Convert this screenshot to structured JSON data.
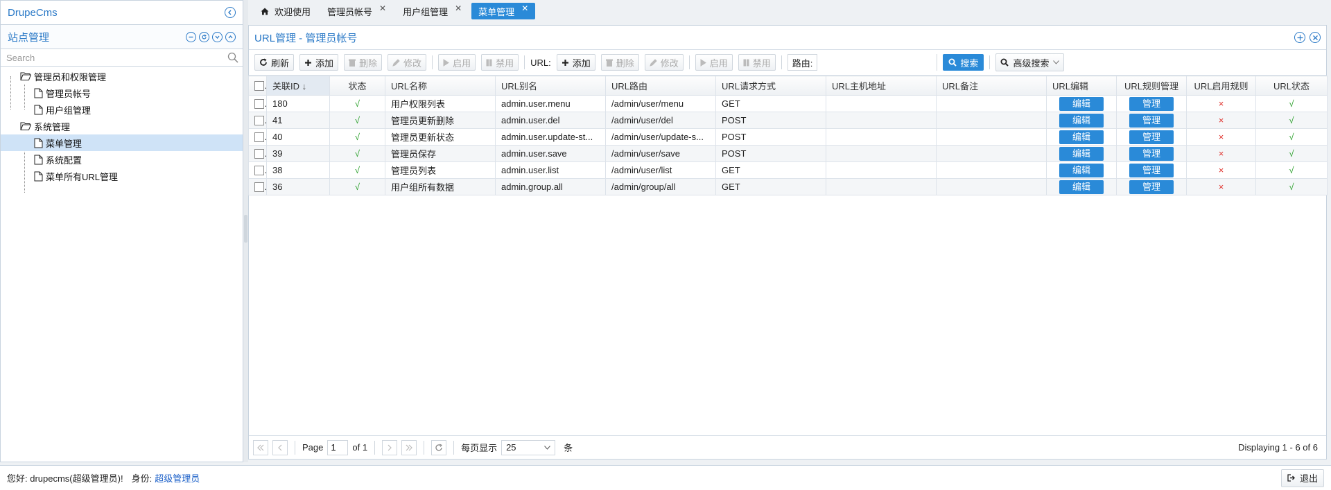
{
  "app": {
    "title": "DrupeCms"
  },
  "sidebar": {
    "title": "站点管理",
    "search_placeholder": "Search",
    "tree": [
      {
        "label": "管理员和权限管理",
        "type": "folder"
      },
      {
        "label": "管理员帐号",
        "type": "file"
      },
      {
        "label": "用户组管理",
        "type": "file"
      },
      {
        "label": "系统管理",
        "type": "folder"
      },
      {
        "label": "菜单管理",
        "type": "file"
      },
      {
        "label": "系统配置",
        "type": "file"
      },
      {
        "label": "菜单所有URL管理",
        "type": "file"
      }
    ]
  },
  "tabs": [
    {
      "label": "欢迎使用"
    },
    {
      "label": "管理员帐号"
    },
    {
      "label": "用户组管理"
    },
    {
      "label": "菜单管理"
    }
  ],
  "panel": {
    "title": "URL管理 - 管理员帐号"
  },
  "toolbar": {
    "refresh": "刷新",
    "add": "添加",
    "delete": "删除",
    "edit": "修改",
    "enable": "启用",
    "disable": "禁用",
    "url_label": "URL:",
    "url_add": "添加",
    "url_delete": "删除",
    "url_edit": "修改",
    "url_enable": "启用",
    "url_disable": "禁用",
    "route_label": "路由:",
    "route_value": "",
    "search": "搜索",
    "advanced": "高级搜索"
  },
  "grid": {
    "columns": [
      "关联ID",
      "状态",
      "URL名称",
      "URL别名",
      "URL路由",
      "URL请求方式",
      "URL主机地址",
      "URL备注",
      "URL编辑",
      "URL规则管理",
      "URL启用规则",
      "URL状态"
    ],
    "sort_arrow": "↓",
    "edit_label": "编辑",
    "manage_label": "管理",
    "rows": [
      {
        "id": "180",
        "status": "√",
        "name": "用户权限列表",
        "alias": "admin.user.menu",
        "route": "/admin/user/menu",
        "method": "GET",
        "host": "",
        "note": "",
        "rule": "×",
        "url_status": "√"
      },
      {
        "id": "41",
        "status": "√",
        "name": "管理员更新删除",
        "alias": "admin.user.del",
        "route": "/admin/user/del",
        "method": "POST",
        "host": "",
        "note": "",
        "rule": "×",
        "url_status": "√"
      },
      {
        "id": "40",
        "status": "√",
        "name": "管理员更新状态",
        "alias": "admin.user.update-st...",
        "route": "/admin/user/update-s...",
        "method": "POST",
        "host": "",
        "note": "",
        "rule": "×",
        "url_status": "√"
      },
      {
        "id": "39",
        "status": "√",
        "name": "管理员保存",
        "alias": "admin.user.save",
        "route": "/admin/user/save",
        "method": "POST",
        "host": "",
        "note": "",
        "rule": "×",
        "url_status": "√"
      },
      {
        "id": "38",
        "status": "√",
        "name": "管理员列表",
        "alias": "admin.user.list",
        "route": "/admin/user/list",
        "method": "GET",
        "host": "",
        "note": "",
        "rule": "×",
        "url_status": "√"
      },
      {
        "id": "36",
        "status": "√",
        "name": "用户组所有数据",
        "alias": "admin.group.all",
        "route": "/admin/group/all",
        "method": "GET",
        "host": "",
        "note": "",
        "rule": "×",
        "url_status": "√"
      }
    ]
  },
  "pager": {
    "page_label": "Page",
    "page": "1",
    "of_label": "of 1",
    "per_page_label": "每页显示",
    "per_page": "25",
    "unit": "条",
    "info": "Displaying 1 - 6 of 6"
  },
  "footer": {
    "greeting": "您好: drupecms(超级管理员)!",
    "role_label": "身份:",
    "role": "超级管理员",
    "logout": "退出"
  },
  "colors": {
    "accent": "#2a8ad8",
    "selected": "#cfe3f7",
    "ok": "#2aa02a",
    "no": "#e0332e"
  }
}
